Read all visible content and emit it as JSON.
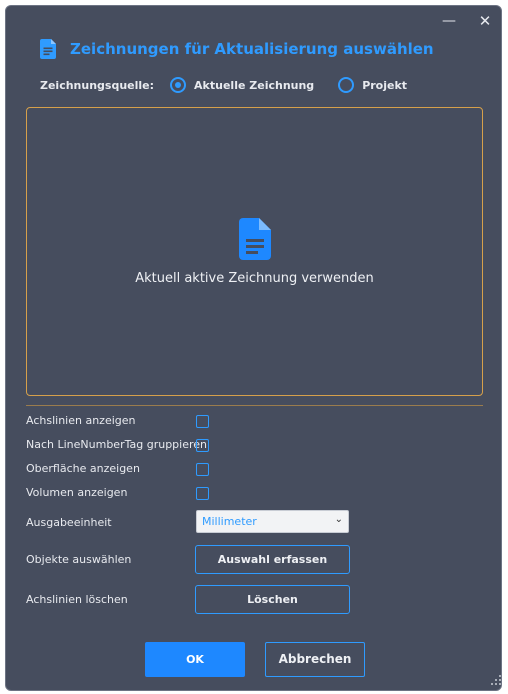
{
  "window": {
    "minimize_symbol": "—",
    "close_symbol": "✕"
  },
  "header": {
    "title": "Zeichnungen für Aktualisierung auswählen",
    "icon": "document-icon"
  },
  "source": {
    "label": "Zeichnungsquelle:",
    "options": [
      {
        "label": "Aktuelle Zeichnung",
        "selected": true
      },
      {
        "label": "Projekt",
        "selected": false
      }
    ]
  },
  "drop_area": {
    "icon": "document-icon",
    "text": "Aktuell aktive Zeichnung verwenden"
  },
  "options": {
    "axis_lines": {
      "label": "Achslinien anzeigen",
      "checked": false
    },
    "group_by_tag": {
      "label": "Nach LineNumberTag gruppieren",
      "checked": false
    },
    "show_surface": {
      "label": "Oberfläche anzeigen",
      "checked": false
    },
    "show_volume": {
      "label": "Volumen anzeigen",
      "checked": false
    },
    "unit": {
      "label": "Ausgabeeinheit",
      "value": "Millimeter"
    },
    "select_objects": {
      "label": "Objekte auswählen",
      "button": "Auswahl erfassen"
    },
    "delete_axis": {
      "label": "Achslinien löschen",
      "button": "Löschen"
    }
  },
  "footer": {
    "ok": "OK",
    "cancel": "Abbrechen"
  },
  "colors": {
    "background": "#464d5e",
    "accent": "#2f9bff",
    "drop_border": "#d6a04b",
    "ok_fill": "#1e88ff"
  }
}
